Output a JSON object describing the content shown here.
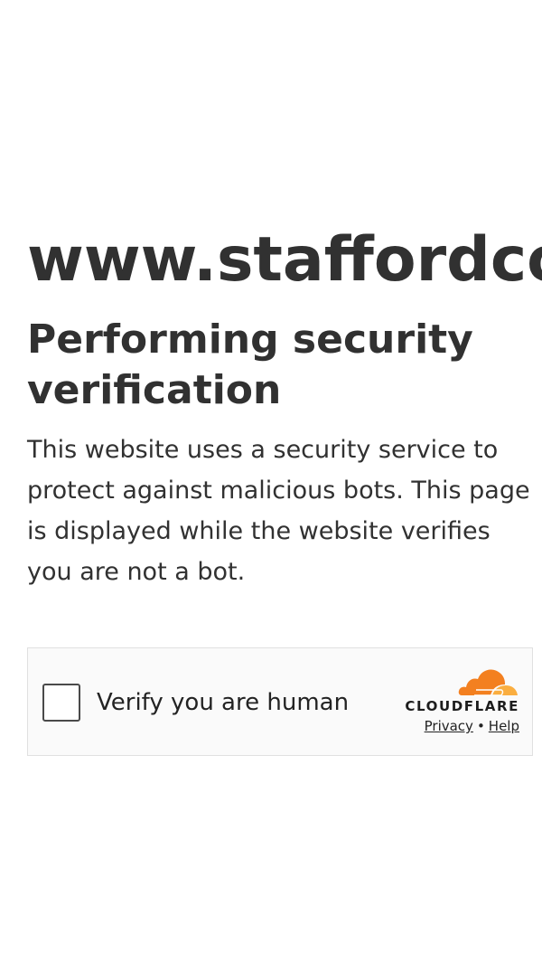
{
  "site": {
    "title": "www.staffordcoffee.com"
  },
  "main": {
    "heading": "Performing security verification",
    "description": "This website uses a security service to protect against malicious bots. This page is displayed while the website verifies you are not a bot."
  },
  "challenge": {
    "checkbox_label": "Verify you are human",
    "checked": false,
    "provider": "CLOUDFLARE",
    "provider_logo_icon": "cloudflare-cloud-icon",
    "privacy_link": "Privacy",
    "separator": "•",
    "help_link": "Help"
  },
  "colors": {
    "text": "#313131",
    "widget_background": "#fafafa",
    "widget_border": "#e0e0e0",
    "cloudflare_orange": "#f38020",
    "cloudflare_light_orange": "#faae40"
  }
}
